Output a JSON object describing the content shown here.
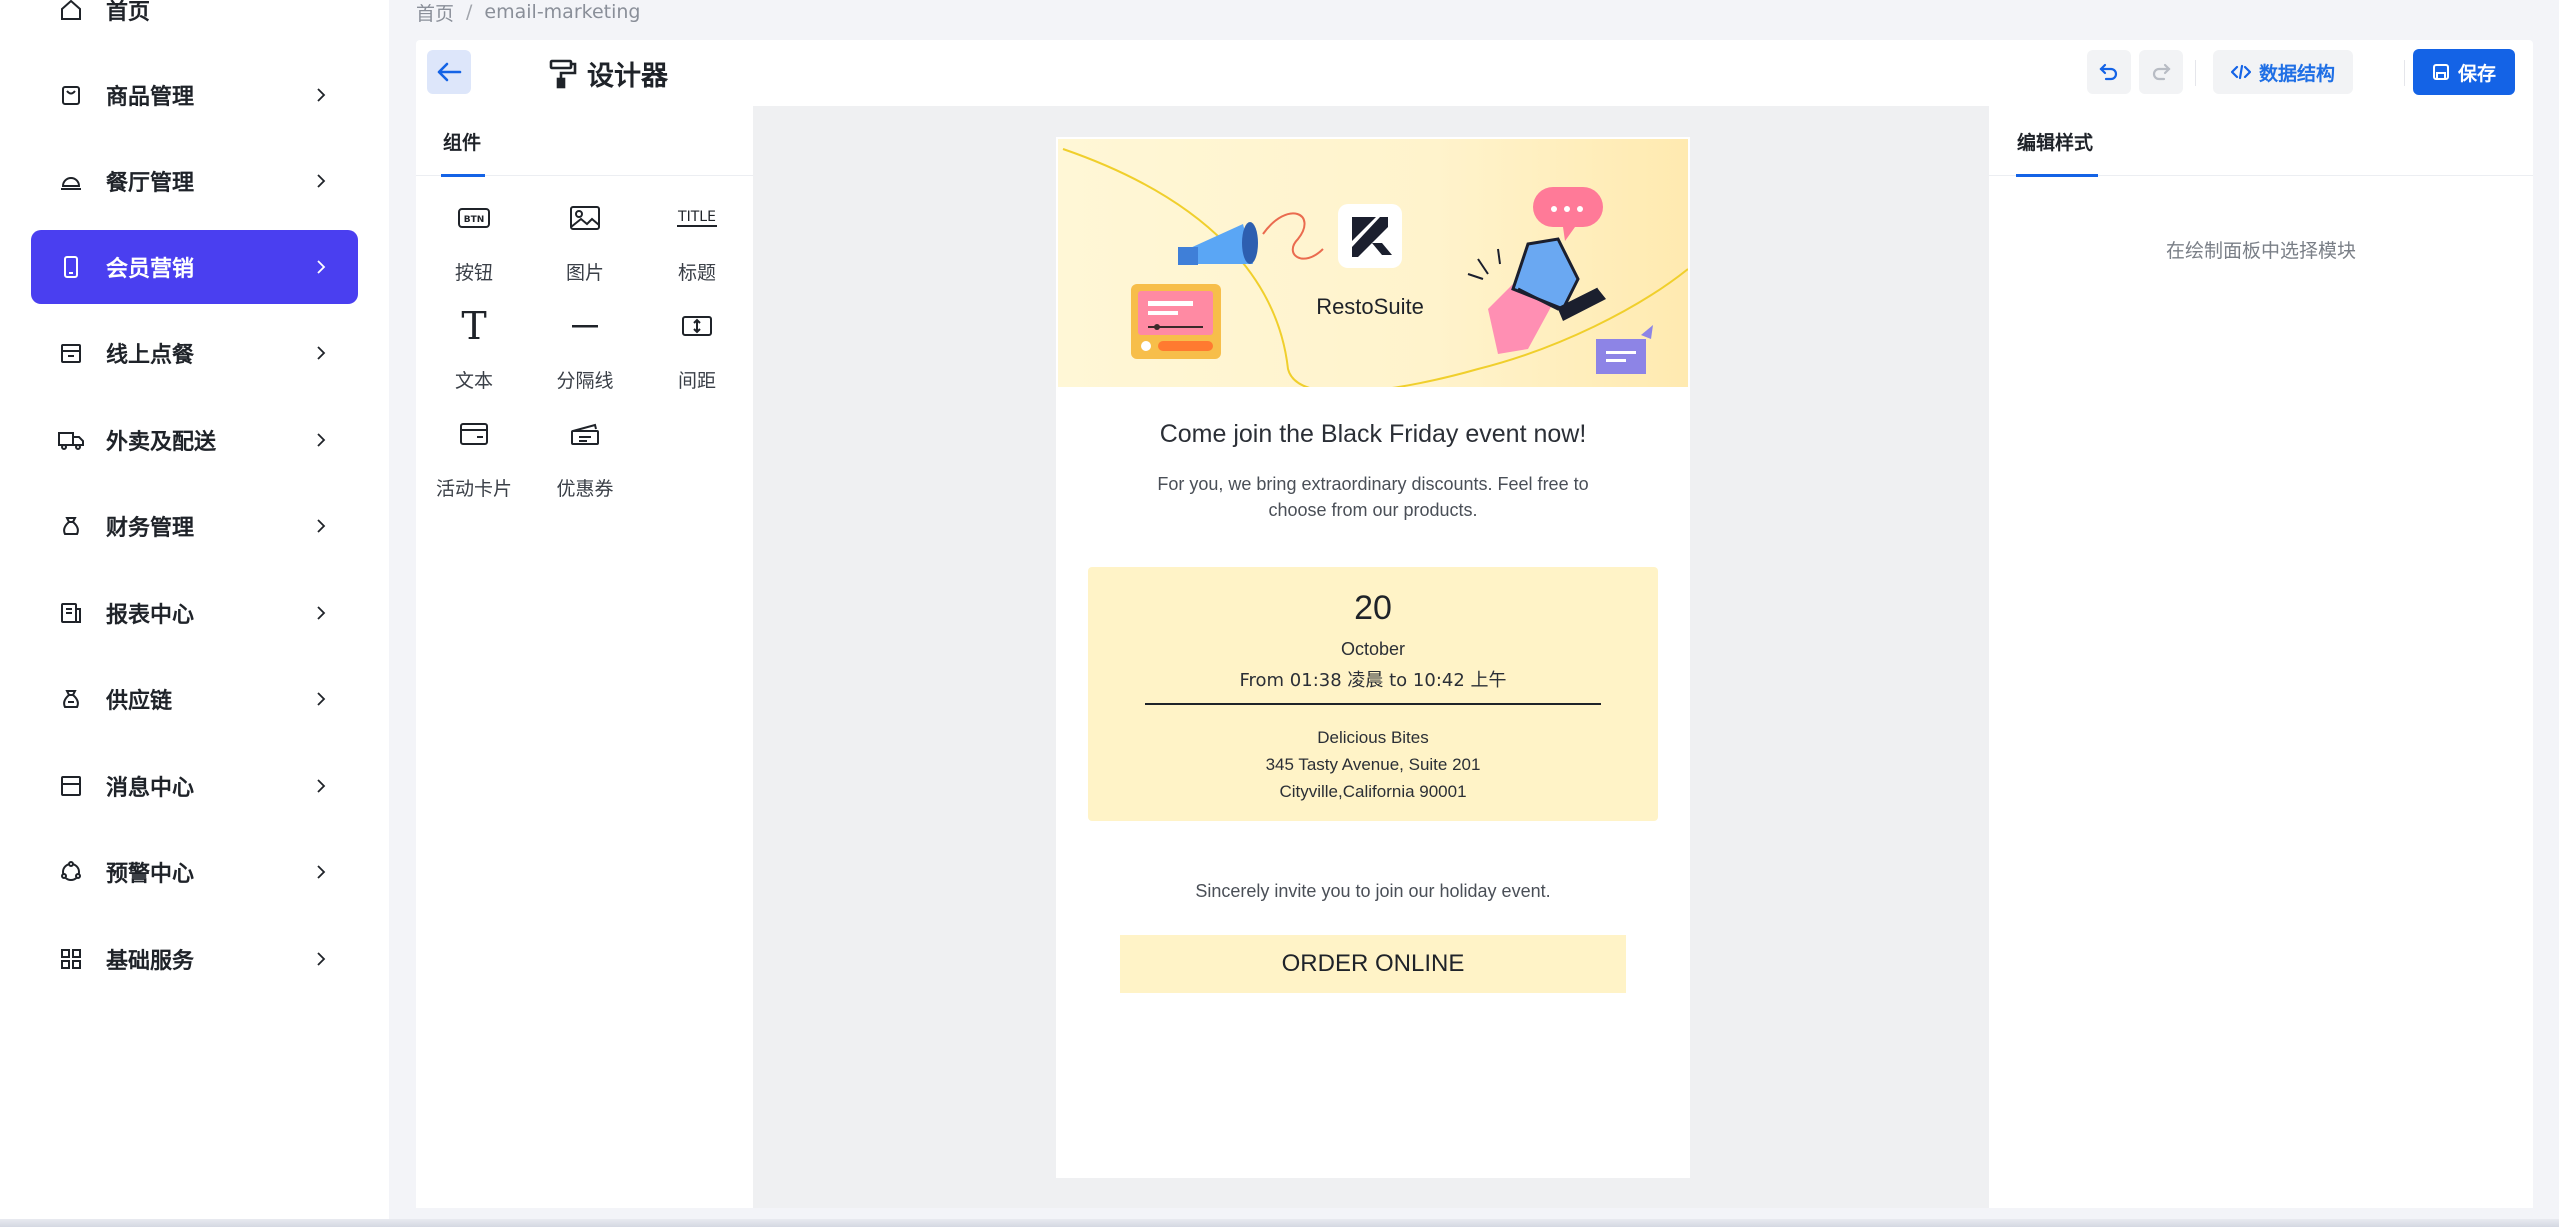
{
  "sidebar": {
    "items": [
      {
        "label": "首页",
        "icon": "home-icon"
      },
      {
        "label": "商品管理",
        "icon": "shopping-bag-icon"
      },
      {
        "label": "餐厅管理",
        "icon": "cloche-icon"
      },
      {
        "label": "会员营销",
        "icon": "mobile-icon",
        "active": true
      },
      {
        "label": "线上点餐",
        "icon": "store-icon"
      },
      {
        "label": "外卖及配送",
        "icon": "truck-icon"
      },
      {
        "label": "财务管理",
        "icon": "money-bag-icon"
      },
      {
        "label": "报表中心",
        "icon": "report-icon"
      },
      {
        "label": "供应链",
        "icon": "supply-chain-icon"
      },
      {
        "label": "消息中心",
        "icon": "inbox-icon"
      },
      {
        "label": "预警中心",
        "icon": "alert-icon"
      },
      {
        "label": "基础服务",
        "icon": "grid-icon"
      }
    ]
  },
  "breadcrumb": {
    "home": "首页",
    "sep": "/",
    "current": "email-marketing"
  },
  "toolbar": {
    "title": "设计器",
    "schema_label": "数据结构",
    "save_label": "保存"
  },
  "components": {
    "tab_label": "组件",
    "items": [
      {
        "label": "按钮",
        "icon": "button-icon",
        "glyph": "BTN"
      },
      {
        "label": "图片",
        "icon": "image-icon"
      },
      {
        "label": "标题",
        "icon": "title-icon",
        "glyph": "TITLE"
      },
      {
        "label": "文本",
        "icon": "text-icon",
        "glyph": "T"
      },
      {
        "label": "分隔线",
        "icon": "divider-icon"
      },
      {
        "label": "间距",
        "icon": "spacing-icon"
      },
      {
        "label": "活动卡片",
        "icon": "event-card-icon"
      },
      {
        "label": "优惠券",
        "icon": "coupon-icon"
      }
    ]
  },
  "email": {
    "brand": "RestoSuite",
    "headline": "Come join the Black Friday event now!",
    "subtext": "For you, we bring extraordinary discounts. Feel free to choose from our products.",
    "event": {
      "day": "20",
      "month": "October",
      "time": "From 01:38 凌晨 to 10:42 上午",
      "venue": "Delicious Bites",
      "address1": "345 Tasty Avenue, Suite 201",
      "address2": "Cityville,California 90001"
    },
    "invite": "Sincerely invite you to join our holiday event.",
    "cta": "ORDER ONLINE"
  },
  "style_panel": {
    "tab_label": "编辑样式",
    "empty_text": "在绘制面板中选择模块"
  },
  "colors": {
    "accent": "#4a3ff0",
    "primary": "#1463e6",
    "event_bg": "#fff3c7"
  }
}
